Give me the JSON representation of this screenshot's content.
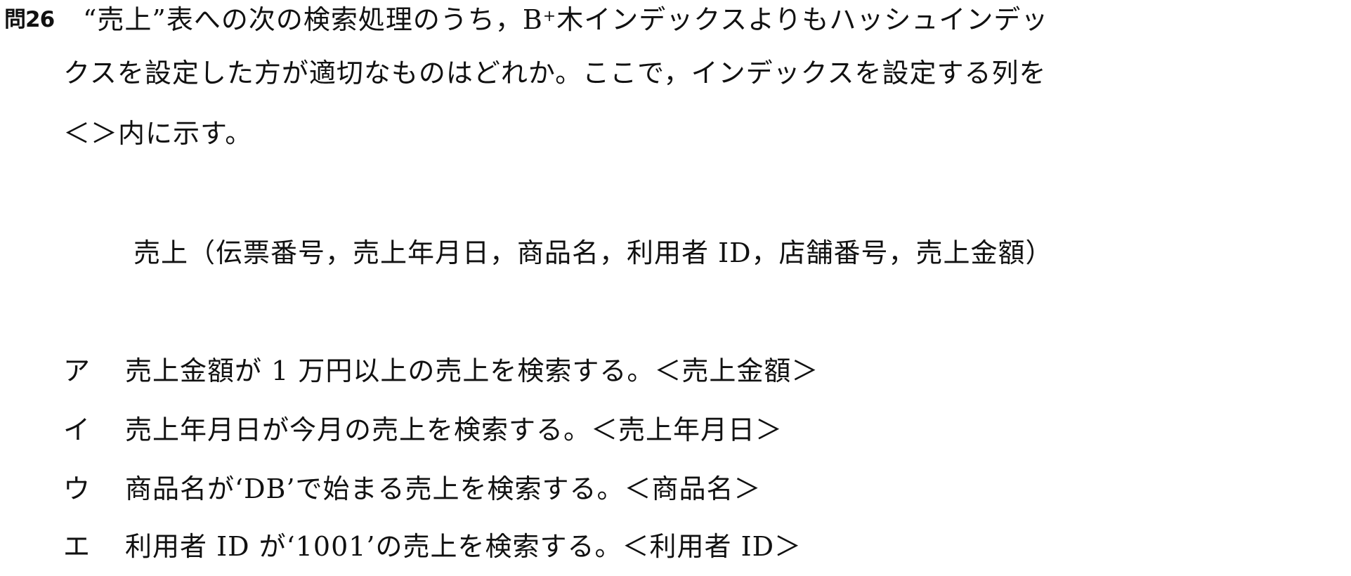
{
  "question": {
    "number": "問26",
    "stem_line1_pre": "“売上”表への次の検索処理のうち，B",
    "stem_line1_sup": "+",
    "stem_line1_post": "木インデックスよりもハッシュインデッ",
    "stem_line2": "クスを設定した方が適切なものはどれか。ここで，インデックスを設定する列を",
    "stem_line3": "＜＞内に示す。"
  },
  "schema": "売上（伝票番号，売上年月日，商品名，利用者 ID，店舗番号，売上金額）",
  "choices": [
    {
      "label": "ア",
      "text": "売上金額が 1 万円以上の売上を検索する。＜売上金額＞"
    },
    {
      "label": "イ",
      "text": "売上年月日が今月の売上を検索する。＜売上年月日＞"
    },
    {
      "label": "ウ",
      "text": "商品名が‘DB’で始まる売上を検索する。＜商品名＞"
    },
    {
      "label": "エ",
      "text": "利用者 ID が‘1001’の売上を検索する。＜利用者 ID＞"
    }
  ]
}
